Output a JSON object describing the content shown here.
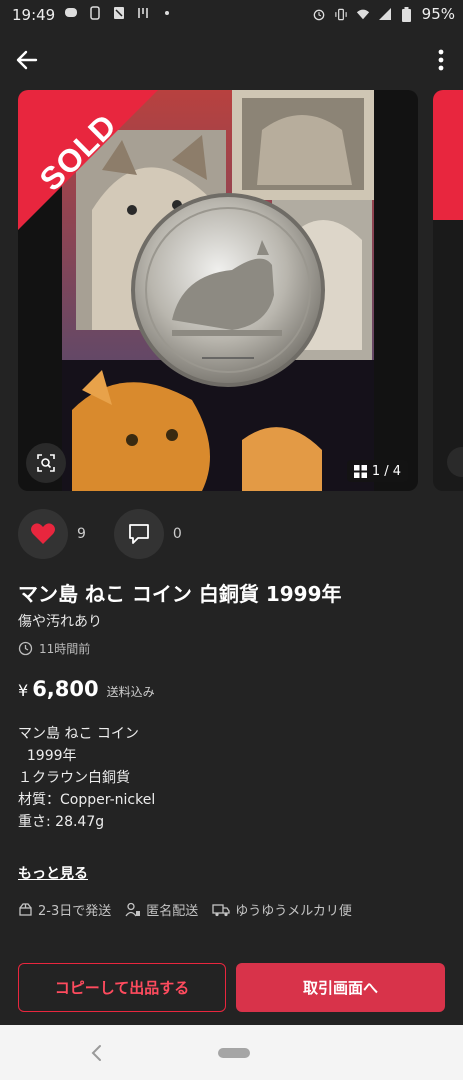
{
  "statusbar": {
    "time": "19:49",
    "battery": "95%"
  },
  "carousel": {
    "sold_label": "SOLD",
    "page": "1 / 4"
  },
  "actions": {
    "likes": "9",
    "comments": "0"
  },
  "item": {
    "title": "マン島 ねこ コイン 白銅貨 1999年",
    "condition": "傷や汚れあり",
    "posted": "11時間前",
    "currency": "¥",
    "price": "6,800",
    "shipping_included": "送料込み",
    "description": [
      "マン島 ねこ コイン",
      "  1999年",
      "１クラウン白銅貨",
      "",
      "材質：Copper-nickel",
      "重さ: 28.47g"
    ],
    "more_label": "もっと見る"
  },
  "shipping": {
    "days": "2-3日で発送",
    "anonymous": "匿名配送",
    "method": "ゆうゆうメルカリ便"
  },
  "buttons": {
    "copy_list": "コピーして出品する",
    "trade_screen": "取引画面へ"
  },
  "colors": {
    "accent": "#e8263e",
    "background": "#232323"
  }
}
